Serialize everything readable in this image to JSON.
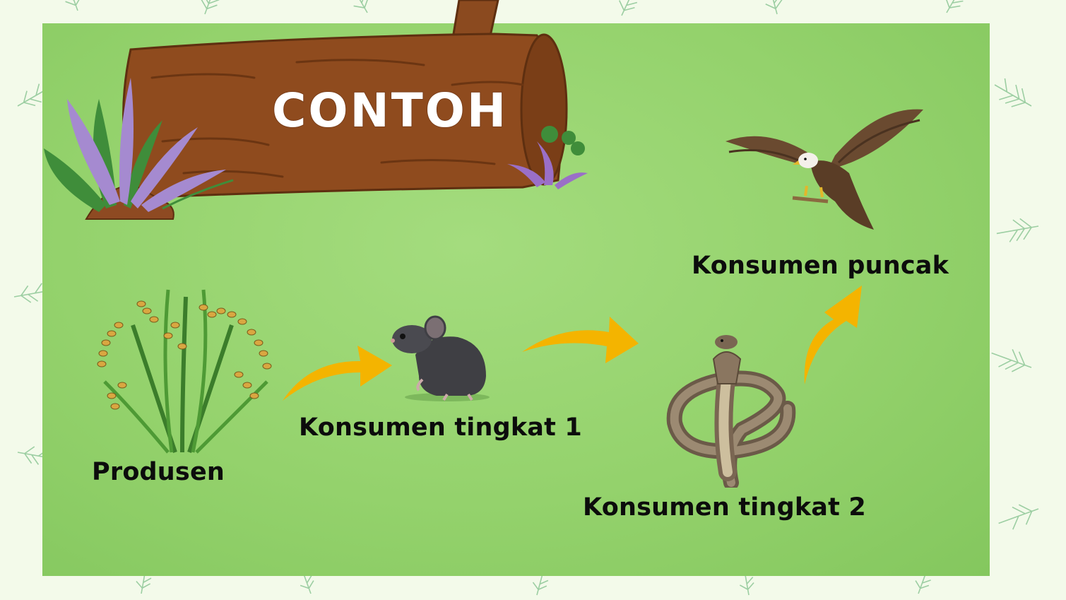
{
  "title": "CONTOH",
  "chain": [
    {
      "label": "Produsen",
      "icon": "rice-plant-icon"
    },
    {
      "label": "Konsumen tingkat 1",
      "icon": "mouse-icon"
    },
    {
      "label": "Konsumen tingkat 2",
      "icon": "cobra-snake-icon"
    },
    {
      "label": "Konsumen puncak",
      "icon": "eagle-icon"
    }
  ],
  "colors": {
    "background": "#f3faea",
    "panel": "#96d36e",
    "arrow": "#f4b400",
    "log": "#8b4513",
    "text": "#0c0c0c"
  }
}
